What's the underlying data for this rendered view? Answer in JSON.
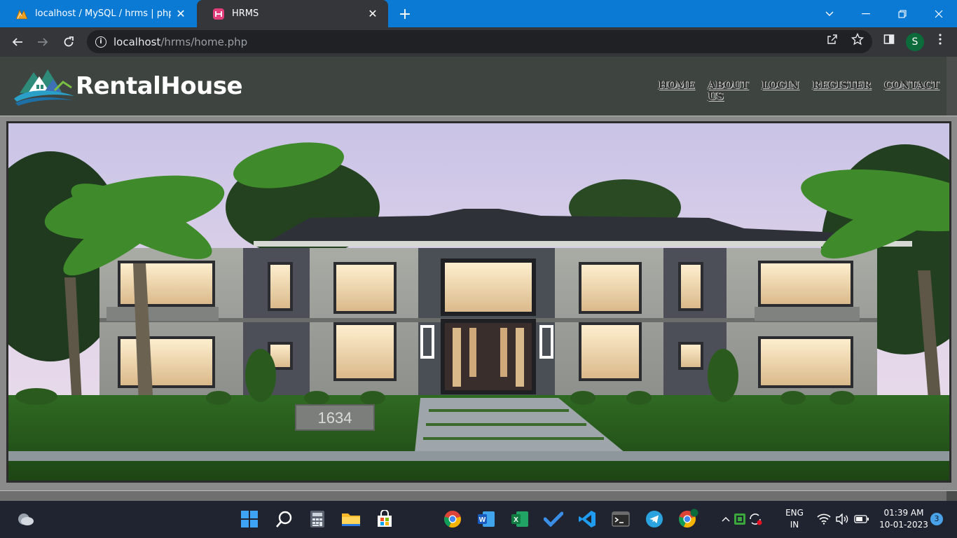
{
  "browser": {
    "tabs": [
      {
        "title": "localhost / MySQL / hrms | phpMyA",
        "icon": "phpmyadmin-icon",
        "active": false
      },
      {
        "title": "HRMS",
        "icon": "hrms-favicon",
        "active": true
      }
    ],
    "close_glyph": "✕",
    "newtab_glyph": "+",
    "url_host": "localhost",
    "url_path": "/hrms/home.php",
    "profile_initial": "S"
  },
  "site": {
    "brand": "RentalHouse",
    "nav": [
      "HOME",
      "ABOUT US",
      "LOGIN",
      "REGISTER",
      "CONTACT"
    ],
    "hero_house_number": "1634"
  },
  "taskbar": {
    "lang_1": "ENG",
    "lang_2": "IN",
    "time": "01:39 AM",
    "date": "10-01-2023",
    "notifications": "3",
    "chrome_profile_badge": "S"
  },
  "colors": {
    "titlebar": "#0b7ad5",
    "tab_active": "#35363a",
    "site_header": "#3e4440",
    "brand": "#ffffff",
    "taskbar": "#1f2430"
  }
}
